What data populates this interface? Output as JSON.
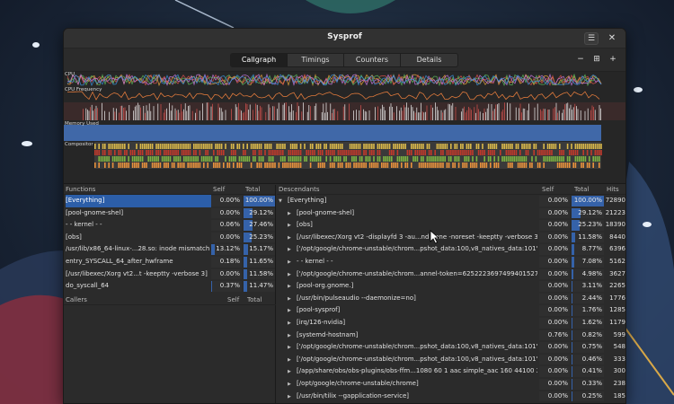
{
  "window": {
    "title": "Sysprof"
  },
  "tabs": [
    "Callgraph",
    "Timings",
    "Counters",
    "Details"
  ],
  "active_tab": 0,
  "icons": {
    "menu": "hamburger-icon",
    "close": "close-icon",
    "zoom_out": "minus-icon",
    "zoom_fit": "fit-icon",
    "zoom_in": "plus-icon"
  },
  "symbols": {
    "menu": "☰",
    "close": "✕",
    "zoom_out": "−",
    "zoom_fit": "⊞",
    "zoom_in": "+",
    "expanded": "▼",
    "collapsed": "▶"
  },
  "visualizers": [
    "CPU",
    "CPU Frequency",
    "",
    "Memory Used",
    "Compositor"
  ],
  "functions": {
    "headers": {
      "name": "Functions",
      "self": "Self",
      "total": "Total"
    },
    "rows": [
      {
        "name": "[Everything]",
        "self": "0.00%",
        "self_pct": 0,
        "total": "100.00%",
        "total_pct": 100,
        "selected": true
      },
      {
        "name": "[pool-gnome-shel]",
        "self": "0.00%",
        "self_pct": 0,
        "total": "29.12%",
        "total_pct": 29.12
      },
      {
        "name": "- - kernel - -",
        "self": "0.06%",
        "self_pct": 0.06,
        "total": "27.46%",
        "total_pct": 27.46
      },
      {
        "name": "[obs]",
        "self": "0.00%",
        "self_pct": 0,
        "total": "25.23%",
        "total_pct": 25.23
      },
      {
        "name": "/usr/lib/x86_64-linux-...28.so: inode mismatch",
        "self": "13.12%",
        "self_pct": 13.12,
        "total": "15.17%",
        "total_pct": 15.17
      },
      {
        "name": "entry_SYSCALL_64_after_hwframe",
        "self": "0.18%",
        "self_pct": 0.18,
        "total": "11.65%",
        "total_pct": 11.65
      },
      {
        "name": "[/usr/libexec/Xorg vt2...t -keeptty -verbose 3]",
        "self": "0.00%",
        "self_pct": 0,
        "total": "11.58%",
        "total_pct": 11.58
      },
      {
        "name": "do_syscall_64",
        "self": "0.37%",
        "self_pct": 0.37,
        "total": "11.47%",
        "total_pct": 11.47
      }
    ]
  },
  "callers": {
    "headers": {
      "name": "Callers",
      "self": "Self",
      "total": "Total"
    }
  },
  "descendants": {
    "headers": {
      "name": "Descendants",
      "self": "Self",
      "total": "Total",
      "hits": "Hits"
    },
    "rows": [
      {
        "name": "[Everything]",
        "expanded": true,
        "depth": 0,
        "self": "0.00%",
        "total": "100.00%",
        "total_pct": 100,
        "hits": "72890"
      },
      {
        "name": "[pool-gnome-shel]",
        "depth": 1,
        "self": "0.00%",
        "total": "29.12%",
        "total_pct": 29.12,
        "hits": "21223"
      },
      {
        "name": "[obs]",
        "depth": 1,
        "self": "0.00%",
        "total": "25.23%",
        "total_pct": 25.23,
        "hits": "18390"
      },
      {
        "name": "[/usr/libexec/Xorg vt2 -displayfd 3 -au...nd none -noreset -keeptty -verbose 3]",
        "depth": 1,
        "self": "0.00%",
        "total": "11.58%",
        "total_pct": 11.58,
        "hits": "8440"
      },
      {
        "name": "['/opt/google/chrome-unstable/chrom...pshot_data:100,v8_natives_data:101']",
        "depth": 1,
        "self": "0.00%",
        "total": "8.77%",
        "total_pct": 8.77,
        "hits": "6396"
      },
      {
        "name": "- - kernel - -",
        "depth": 1,
        "self": "0.00%",
        "total": "7.08%",
        "total_pct": 7.08,
        "hits": "5162"
      },
      {
        "name": "['/opt/google/chrome-unstable/chrom...annel-token=6252223697499401527']",
        "depth": 1,
        "self": "0.00%",
        "total": "4.98%",
        "total_pct": 4.98,
        "hits": "3627"
      },
      {
        "name": "[pool-org.gnome.]",
        "depth": 1,
        "self": "0.00%",
        "total": "3.11%",
        "total_pct": 3.11,
        "hits": "2265"
      },
      {
        "name": "[/usr/bin/pulseaudio --daemonize=no]",
        "depth": 1,
        "self": "0.00%",
        "total": "2.44%",
        "total_pct": 2.44,
        "hits": "1776"
      },
      {
        "name": "[pool-sysprof]",
        "depth": 1,
        "self": "0.00%",
        "total": "1.76%",
        "total_pct": 1.76,
        "hits": "1285"
      },
      {
        "name": "[irq/126-nvidia]",
        "depth": 1,
        "self": "0.00%",
        "total": "1.62%",
        "total_pct": 1.62,
        "hits": "1179"
      },
      {
        "name": "[systemd-hostnam]",
        "depth": 1,
        "self": "0.76%",
        "total": "0.82%",
        "total_pct": 0.82,
        "hits": "599"
      },
      {
        "name": "['/opt/google/chrome-unstable/chrom...pshot_data:100,v8_natives_data:101']",
        "depth": 1,
        "self": "0.00%",
        "total": "0.75%",
        "total_pct": 0.75,
        "hits": "548"
      },
      {
        "name": "['/opt/google/chrome-unstable/chrom...pshot_data:100,v8_natives_data:101']",
        "depth": 1,
        "self": "0.00%",
        "total": "0.46%",
        "total_pct": 0.46,
        "hits": "333"
      },
      {
        "name": "[/app/share/obs/obs-plugins/obs-ffm...1080 60 1 aac simple_aac 160 44100 2]",
        "depth": 1,
        "self": "0.00%",
        "total": "0.41%",
        "total_pct": 0.41,
        "hits": "300"
      },
      {
        "name": "[/opt/google/chrome-unstable/chrome]",
        "depth": 1,
        "self": "0.00%",
        "total": "0.33%",
        "total_pct": 0.33,
        "hits": "238"
      },
      {
        "name": "[/usr/bin/tilix --gapplication-service]",
        "depth": 1,
        "self": "0.00%",
        "total": "0.25%",
        "total_pct": 0.25,
        "hits": "185"
      }
    ]
  },
  "colors": {
    "selection": "#2c5ea8",
    "bar": "#3562a9",
    "cpu_series": [
      "#e8a43c",
      "#d9534f",
      "#5cb85c",
      "#c678dd",
      "#3a8fd8"
    ],
    "freq_series": "#e07a3c",
    "mem_fill": "#4068a8",
    "compositor": [
      "#d9b84a",
      "#c0392b",
      "#7cb342",
      "#e8923c"
    ]
  }
}
